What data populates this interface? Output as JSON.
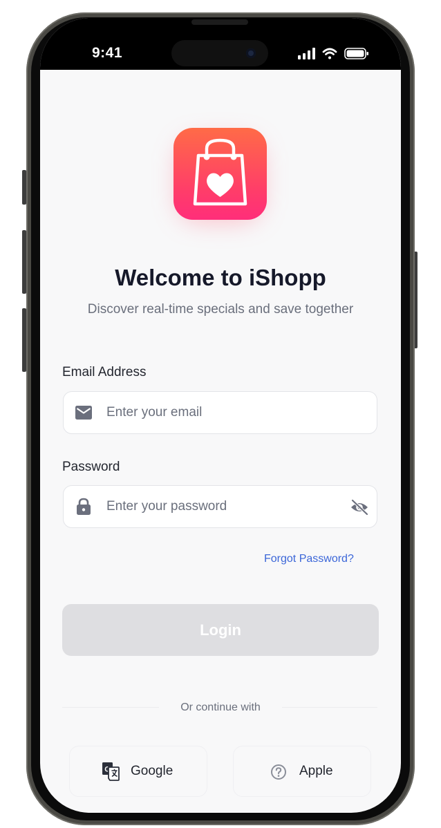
{
  "status_bar": {
    "time": "9:41",
    "icons": [
      "signal-icon",
      "wifi-icon",
      "battery-icon"
    ]
  },
  "app": {
    "logo_icon": "shopping-bag-heart-icon",
    "colors": {
      "logo_gradient_top": "#ff6b47",
      "logo_gradient_bottom": "#ff2e7a",
      "link": "#3b66d8",
      "button_disabled": "#dedee1",
      "title": "#16192a"
    },
    "title": "Welcome to iShopp",
    "subtitle": "Discover real-time specials and save together"
  },
  "form": {
    "email": {
      "label": "Email Address",
      "placeholder": "Enter your email",
      "value": "",
      "icon": "mail-icon"
    },
    "password": {
      "label": "Password",
      "placeholder": "Enter your password",
      "value": "",
      "icon": "lock-icon",
      "toggle_icon": "eye-off-icon"
    },
    "forgot_password": "Forgot Password?",
    "login_label": "Login"
  },
  "social": {
    "divider": "Or continue with",
    "google_label": "Google",
    "google_icon": "google-translate-icon",
    "apple_label": "Apple",
    "apple_icon": "help-circle-icon"
  }
}
